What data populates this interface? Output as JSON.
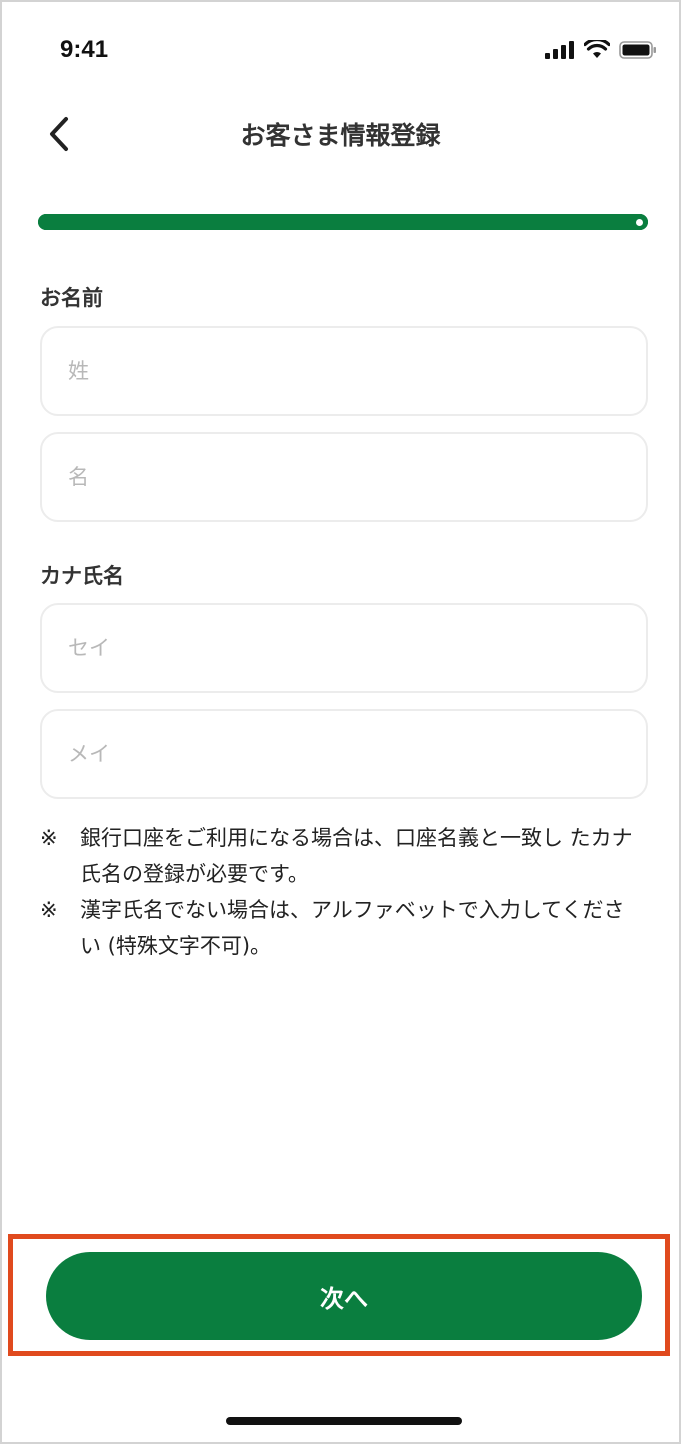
{
  "status_bar": {
    "time": "9:41",
    "icons": [
      "signal-icon",
      "wifi-icon",
      "battery-icon"
    ]
  },
  "header": {
    "back_icon": "chevron-left-icon",
    "title": "お客さま情報登録"
  },
  "progress": {
    "value_percent": 100,
    "color": "#0a7e3f"
  },
  "form": {
    "name_section_label": "お名前",
    "last_name_placeholder": "姓",
    "first_name_placeholder": "名",
    "last_name_value": "",
    "first_name_value": "",
    "kana_section_label": "カナ氏名",
    "last_name_kana_placeholder": "セイ",
    "first_name_kana_placeholder": "メイ",
    "last_name_kana_value": "",
    "first_name_kana_value": ""
  },
  "notes": [
    {
      "mark": "※",
      "text": "銀行口座をご利用になる場合は、口座名義と一致し たカナ氏名の登録が必要です。"
    },
    {
      "mark": "※",
      "text": "漢字氏名でない場合は、アルファベットで入力してください (特殊文字不可)。"
    }
  ],
  "footer": {
    "next_label": "次へ"
  },
  "colors": {
    "brand_green": "#0a7e3f",
    "highlight_border": "#e04a1e"
  }
}
